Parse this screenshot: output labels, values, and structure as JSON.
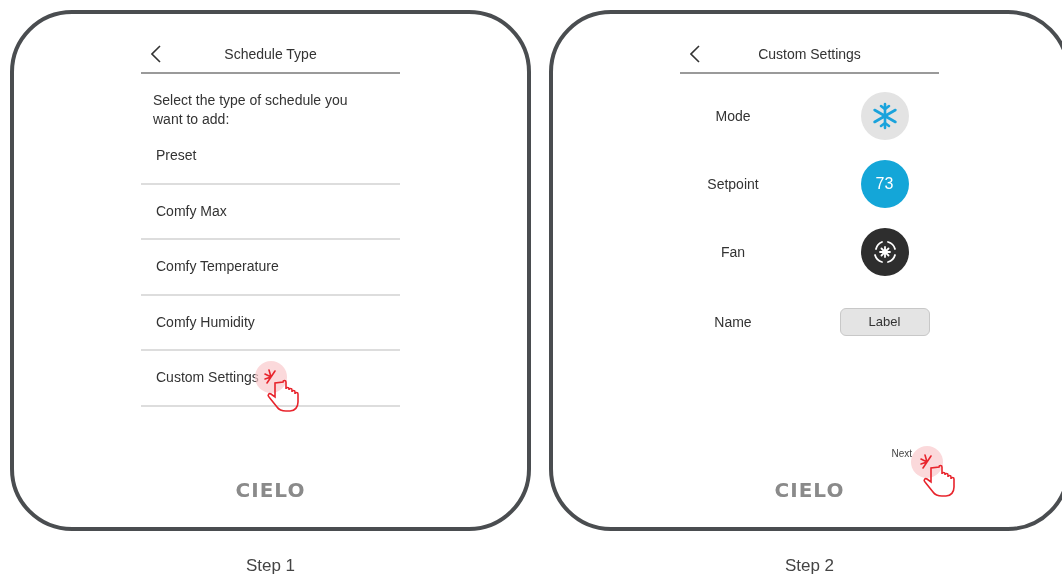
{
  "screens": [
    {
      "kind": "list",
      "title": "Schedule Type",
      "prompt": "Select the type of schedule you want to add:",
      "options": [
        {
          "label": "Preset",
          "tapped": false
        },
        {
          "label": "Comfy Max",
          "tapped": false
        },
        {
          "label": "Comfy Temperature",
          "tapped": false
        },
        {
          "label": "Comfy Humidity",
          "tapped": false
        },
        {
          "label": "Custom Settings",
          "tapped": true
        }
      ],
      "logo": "CIELO",
      "caption": "Step 1"
    },
    {
      "kind": "settings",
      "title": "Custom Settings",
      "settings": [
        {
          "kind": "mode",
          "label": "Mode"
        },
        {
          "kind": "setpoint",
          "label": "Setpoint",
          "value": "73"
        },
        {
          "kind": "fan",
          "label": "Fan"
        },
        {
          "kind": "name",
          "label": "Name",
          "value": "Label"
        }
      ],
      "next": {
        "label": "Next",
        "tapped": true
      },
      "logo": "CIELO",
      "caption": "Step 2"
    }
  ]
}
